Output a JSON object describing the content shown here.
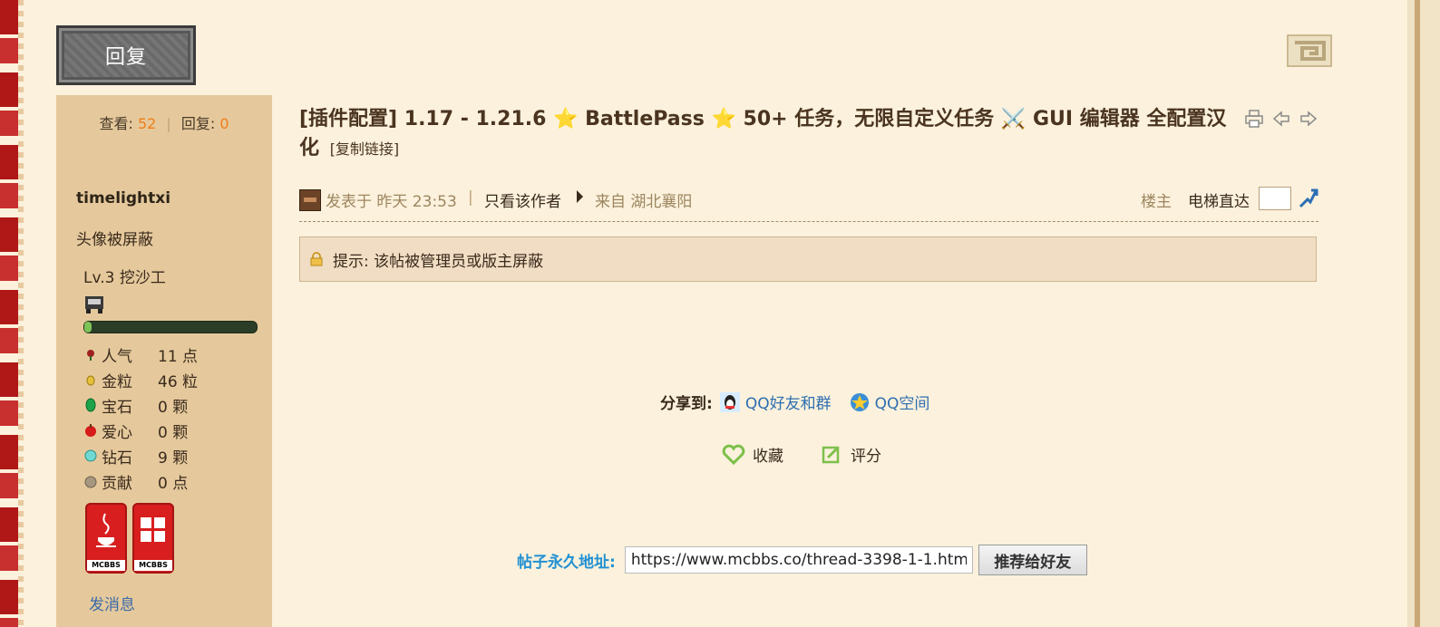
{
  "reply_button": {
    "label": "回复"
  },
  "sidebar": {
    "views_label": "查看:",
    "views_value": "52",
    "replies_label": "回复:",
    "replies_value": "0",
    "username": "timelightxi",
    "avatar_text": "头像被屏蔽",
    "level": "Lv.3 挖沙工",
    "level_progress": 0.04,
    "props": [
      {
        "icon": "rose-icon",
        "label": "人气",
        "value": "11 点"
      },
      {
        "icon": "gold-nugget-icon",
        "label": "金粒",
        "value": "46 粒"
      },
      {
        "icon": "emerald-icon",
        "label": "宝石",
        "value": "0 颗"
      },
      {
        "icon": "apple-icon",
        "label": "爱心",
        "value": "0 颗"
      },
      {
        "icon": "diamond-icon",
        "label": "钻石",
        "value": "9 颗"
      },
      {
        "icon": "clay-ball-icon",
        "label": "贡献",
        "value": "0 点"
      }
    ],
    "badges": [
      "MCBBS",
      "MCBBS"
    ],
    "send_message": "发消息"
  },
  "post": {
    "title": "[插件配置] 1.17 - 1.21.6 ⭐ BattlePass ⭐ 50+ 任务，无限自定义任务 ⚔️ GUI 编辑器 全配置汉化",
    "copy_link": "[复制链接]",
    "posted_at": "发表于 昨天 23:53",
    "separator": "|",
    "author_only": "只看该作者",
    "from": "来自 湖北襄阳",
    "floor": "楼主",
    "elevator_label": "电梯直达",
    "notice": "提示: 该帖被管理员或版主屏蔽"
  },
  "share": {
    "label": "分享到:",
    "qq_friends": "QQ好友和群",
    "qq_zone": "QQ空间"
  },
  "actions": {
    "favorite": "收藏",
    "rate": "评分"
  },
  "permalink": {
    "label": "帖子永久地址:",
    "url": "https://www.mcbbs.co/thread-3398-1-1.htm",
    "recommend": "推荐给好友"
  },
  "colors": {
    "page_bg": "#fbf1dc",
    "sidebar_bg": "#e5c99c",
    "accent_orange": "#f07e1a",
    "link_blue": "#2f6fb0",
    "permalink_blue": "#2190d2",
    "notice_bg": "#f1ddc3"
  }
}
